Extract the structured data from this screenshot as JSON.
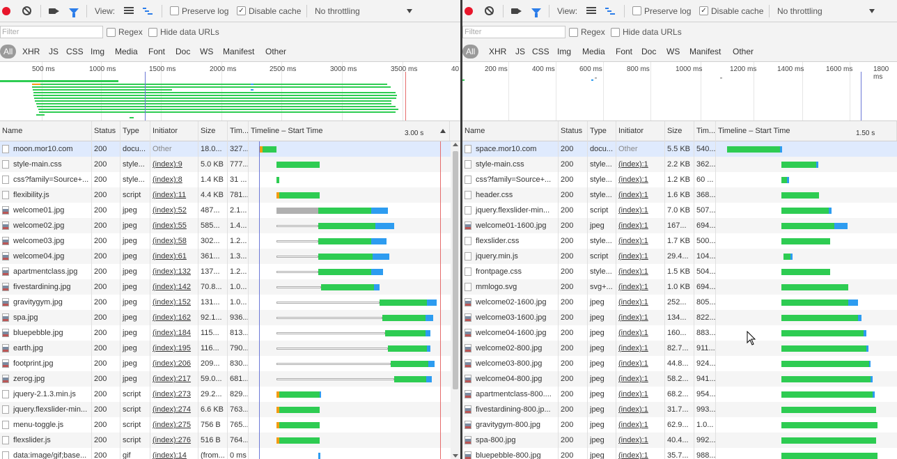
{
  "toolbar": {
    "view_label": "View:",
    "preserve_log": "Preserve log",
    "disable_cache": "Disable cache",
    "throttling": "No throttling"
  },
  "filter": {
    "placeholder": "Filter",
    "regex": "Regex",
    "hide_data_urls": "Hide data URLs"
  },
  "types": [
    "All",
    "XHR",
    "JS",
    "CSS",
    "Img",
    "Media",
    "Font",
    "Doc",
    "WS",
    "Manifest",
    "Other"
  ],
  "columns": {
    "name": "Name",
    "status": "Status",
    "type": "Type",
    "initiator": "Initiator",
    "size": "Size",
    "time": "Tim...",
    "timeline": "Timeline – Start Time"
  },
  "colors": {
    "waiting": "#2ecc52",
    "download": "#2d9cf0",
    "queued": "#b0b0b0",
    "dns": "#f39c12",
    "recording": "#e8162b"
  },
  "left": {
    "overview_ticks": [
      "500 ms",
      "1000 ms",
      "1500 ms",
      "2000 ms",
      "2500 ms",
      "3000 ms",
      "3500 ms",
      "40"
    ],
    "timeline_marker": "3.00 s",
    "rows": [
      {
        "name": "moon.mor10.com",
        "status": "200",
        "type": "docu...",
        "initiator": "Other",
        "size": "18.0...",
        "time": "327...",
        "icon": "document"
      },
      {
        "name": "style-main.css",
        "status": "200",
        "type": "style...",
        "initiator": "(index):9",
        "size": "5.0 KB",
        "time": "777...",
        "icon": "file"
      },
      {
        "name": "css?family=Source+...",
        "status": "200",
        "type": "style...",
        "initiator": "(index):8",
        "size": "1.4 KB",
        "time": "31 ...",
        "icon": "file"
      },
      {
        "name": "flexibility.js",
        "status": "200",
        "type": "script",
        "initiator": "(index):11",
        "size": "4.4 KB",
        "time": "781...",
        "icon": "file"
      },
      {
        "name": "welcome01.jpg",
        "status": "200",
        "type": "jpeg",
        "initiator": "(index):52",
        "size": "487...",
        "time": "2.1...",
        "icon": "image"
      },
      {
        "name": "welcome02.jpg",
        "status": "200",
        "type": "jpeg",
        "initiator": "(index):55",
        "size": "585...",
        "time": "1.4...",
        "icon": "image"
      },
      {
        "name": "welcome03.jpg",
        "status": "200",
        "type": "jpeg",
        "initiator": "(index):58",
        "size": "302...",
        "time": "1.2...",
        "icon": "image"
      },
      {
        "name": "welcome04.jpg",
        "status": "200",
        "type": "jpeg",
        "initiator": "(index):61",
        "size": "361...",
        "time": "1.3...",
        "icon": "image"
      },
      {
        "name": "apartmentclass.jpg",
        "status": "200",
        "type": "jpeg",
        "initiator": "(index):132",
        "size": "137...",
        "time": "1.2...",
        "icon": "image"
      },
      {
        "name": "fivestardining.jpg",
        "status": "200",
        "type": "jpeg",
        "initiator": "(index):142",
        "size": "70.8...",
        "time": "1.0...",
        "icon": "image"
      },
      {
        "name": "gravitygym.jpg",
        "status": "200",
        "type": "jpeg",
        "initiator": "(index):152",
        "size": "131...",
        "time": "1.0...",
        "icon": "image"
      },
      {
        "name": "spa.jpg",
        "status": "200",
        "type": "jpeg",
        "initiator": "(index):162",
        "size": "92.1...",
        "time": "936...",
        "icon": "image"
      },
      {
        "name": "bluepebble.jpg",
        "status": "200",
        "type": "jpeg",
        "initiator": "(index):184",
        "size": "115...",
        "time": "813...",
        "icon": "image"
      },
      {
        "name": "earth.jpg",
        "status": "200",
        "type": "jpeg",
        "initiator": "(index):195",
        "size": "116...",
        "time": "790...",
        "icon": "image"
      },
      {
        "name": "footprint.jpg",
        "status": "200",
        "type": "jpeg",
        "initiator": "(index):206",
        "size": "209...",
        "time": "830...",
        "icon": "image"
      },
      {
        "name": "zerog.jpg",
        "status": "200",
        "type": "jpeg",
        "initiator": "(index):217",
        "size": "59.0...",
        "time": "681...",
        "icon": "image"
      },
      {
        "name": "jquery-2.1.3.min.js",
        "status": "200",
        "type": "script",
        "initiator": "(index):273",
        "size": "29.2...",
        "time": "829...",
        "icon": "file"
      },
      {
        "name": "jquery.flexslider-min...",
        "status": "200",
        "type": "script",
        "initiator": "(index):274",
        "size": "6.6 KB",
        "time": "763...",
        "icon": "file"
      },
      {
        "name": "menu-toggle.js",
        "status": "200",
        "type": "script",
        "initiator": "(index):275",
        "size": "756 B",
        "time": "765...",
        "icon": "file"
      },
      {
        "name": "flexslider.js",
        "status": "200",
        "type": "script",
        "initiator": "(index):276",
        "size": "516 B",
        "time": "764...",
        "icon": "file"
      },
      {
        "name": "data:image/gif;base...",
        "status": "200",
        "type": "gif",
        "initiator": "(index):14",
        "size": "(from...",
        "time": "0 ms",
        "icon": "file"
      }
    ]
  },
  "right": {
    "overview_ticks": [
      "200 ms",
      "400 ms",
      "600 ms",
      "800 ms",
      "1000 ms",
      "1200 ms",
      "1400 ms",
      "1600 ms",
      "1800 ms"
    ],
    "timeline_marker": "1.50 s",
    "rows": [
      {
        "name": "space.mor10.com",
        "status": "200",
        "type": "docu...",
        "initiator": "Other",
        "size": "5.5 KB",
        "time": "540...",
        "icon": "document"
      },
      {
        "name": "style-main.css",
        "status": "200",
        "type": "style...",
        "initiator": "(index):1",
        "size": "2.2 KB",
        "time": "362...",
        "icon": "file"
      },
      {
        "name": "css?family=Source+...",
        "status": "200",
        "type": "style...",
        "initiator": "(index):1",
        "size": "1.2 KB",
        "time": "60 ...",
        "icon": "file"
      },
      {
        "name": "header.css",
        "status": "200",
        "type": "style...",
        "initiator": "(index):1",
        "size": "1.6 KB",
        "time": "368...",
        "icon": "file"
      },
      {
        "name": "jquery.flexslider-min...",
        "status": "200",
        "type": "script",
        "initiator": "(index):1",
        "size": "7.0 KB",
        "time": "507...",
        "icon": "file"
      },
      {
        "name": "welcome01-1600.jpg",
        "status": "200",
        "type": "jpeg",
        "initiator": "(index):1",
        "size": "167...",
        "time": "694...",
        "icon": "image"
      },
      {
        "name": "flexslider.css",
        "status": "200",
        "type": "style...",
        "initiator": "(index):1",
        "size": "1.7 KB",
        "time": "500...",
        "icon": "file"
      },
      {
        "name": "jquery.min.js",
        "status": "200",
        "type": "script",
        "initiator": "(index):1",
        "size": "29.4...",
        "time": "104...",
        "icon": "file"
      },
      {
        "name": "frontpage.css",
        "status": "200",
        "type": "style...",
        "initiator": "(index):1",
        "size": "1.5 KB",
        "time": "504...",
        "icon": "file"
      },
      {
        "name": "mmlogo.svg",
        "status": "200",
        "type": "svg+...",
        "initiator": "(index):1",
        "size": "1.0 KB",
        "time": "694...",
        "icon": "file"
      },
      {
        "name": "welcome02-1600.jpg",
        "status": "200",
        "type": "jpeg",
        "initiator": "(index):1",
        "size": "252...",
        "time": "805...",
        "icon": "image"
      },
      {
        "name": "welcome03-1600.jpg",
        "status": "200",
        "type": "jpeg",
        "initiator": "(index):1",
        "size": "134...",
        "time": "822...",
        "icon": "image"
      },
      {
        "name": "welcome04-1600.jpg",
        "status": "200",
        "type": "jpeg",
        "initiator": "(index):1",
        "size": "160...",
        "time": "883...",
        "icon": "image"
      },
      {
        "name": "welcome02-800.jpg",
        "status": "200",
        "type": "jpeg",
        "initiator": "(index):1",
        "size": "82.7...",
        "time": "911...",
        "icon": "image"
      },
      {
        "name": "welcome03-800.jpg",
        "status": "200",
        "type": "jpeg",
        "initiator": "(index):1",
        "size": "44.8...",
        "time": "924...",
        "icon": "image"
      },
      {
        "name": "welcome04-800.jpg",
        "status": "200",
        "type": "jpeg",
        "initiator": "(index):1",
        "size": "58.2...",
        "time": "941...",
        "icon": "image"
      },
      {
        "name": "apartmentclass-800....",
        "status": "200",
        "type": "jpeg",
        "initiator": "(index):1",
        "size": "68.2...",
        "time": "954...",
        "icon": "image"
      },
      {
        "name": "fivestardining-800.jp...",
        "status": "200",
        "type": "jpeg",
        "initiator": "(index):1",
        "size": "31.7...",
        "time": "993...",
        "icon": "image"
      },
      {
        "name": "gravitygym-800.jpg",
        "status": "200",
        "type": "jpeg",
        "initiator": "(index):1",
        "size": "62.9...",
        "time": "1.0...",
        "icon": "image"
      },
      {
        "name": "spa-800.jpg",
        "status": "200",
        "type": "jpeg",
        "initiator": "(index):1",
        "size": "40.4...",
        "time": "992...",
        "icon": "image"
      },
      {
        "name": "bluepebble-800.jpg",
        "status": "200",
        "type": "jpeg",
        "initiator": "(index):1",
        "size": "35.7...",
        "time": "988...",
        "icon": "image"
      }
    ]
  }
}
